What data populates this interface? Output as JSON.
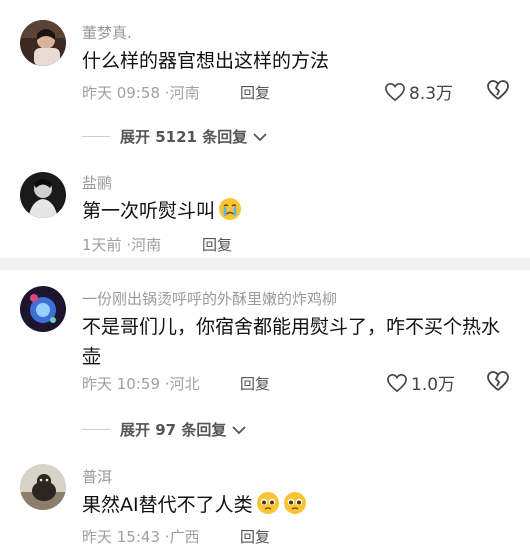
{
  "comments": [
    {
      "username": "董梦真.",
      "text": "什么样的器官想出这样的方法",
      "time": "昨天 09:58",
      "location": "河南",
      "reply_label": "回复",
      "likes": "8.3万",
      "expand_label": "展开 5121 条回复"
    },
    {
      "username": "盐鹂",
      "text": "第一次听熨斗叫",
      "emoji": "crying-face",
      "time": "1天前",
      "location": "河南",
      "reply_label": "回复"
    },
    {
      "username": "一份刚出锅烫呼呼的外酥里嫩的炸鸡柳",
      "text": "不是哥们儿，你宿舍都能用熨斗了，咋不买个热水壶",
      "time": "昨天 10:59",
      "location": "河北",
      "reply_label": "回复",
      "likes": "1.0万",
      "expand_label": "展开 97 条回复"
    },
    {
      "username": "普洱",
      "text": "果然AI替代不了人类",
      "emoji": "pleading-face",
      "time": "昨天 15:43",
      "location": "广西",
      "reply_label": "回复"
    }
  ],
  "separator": "·",
  "colors": {
    "secondary_text": "#9a9a9a",
    "background": "#ffffff",
    "divider": "#f1f1f1"
  }
}
